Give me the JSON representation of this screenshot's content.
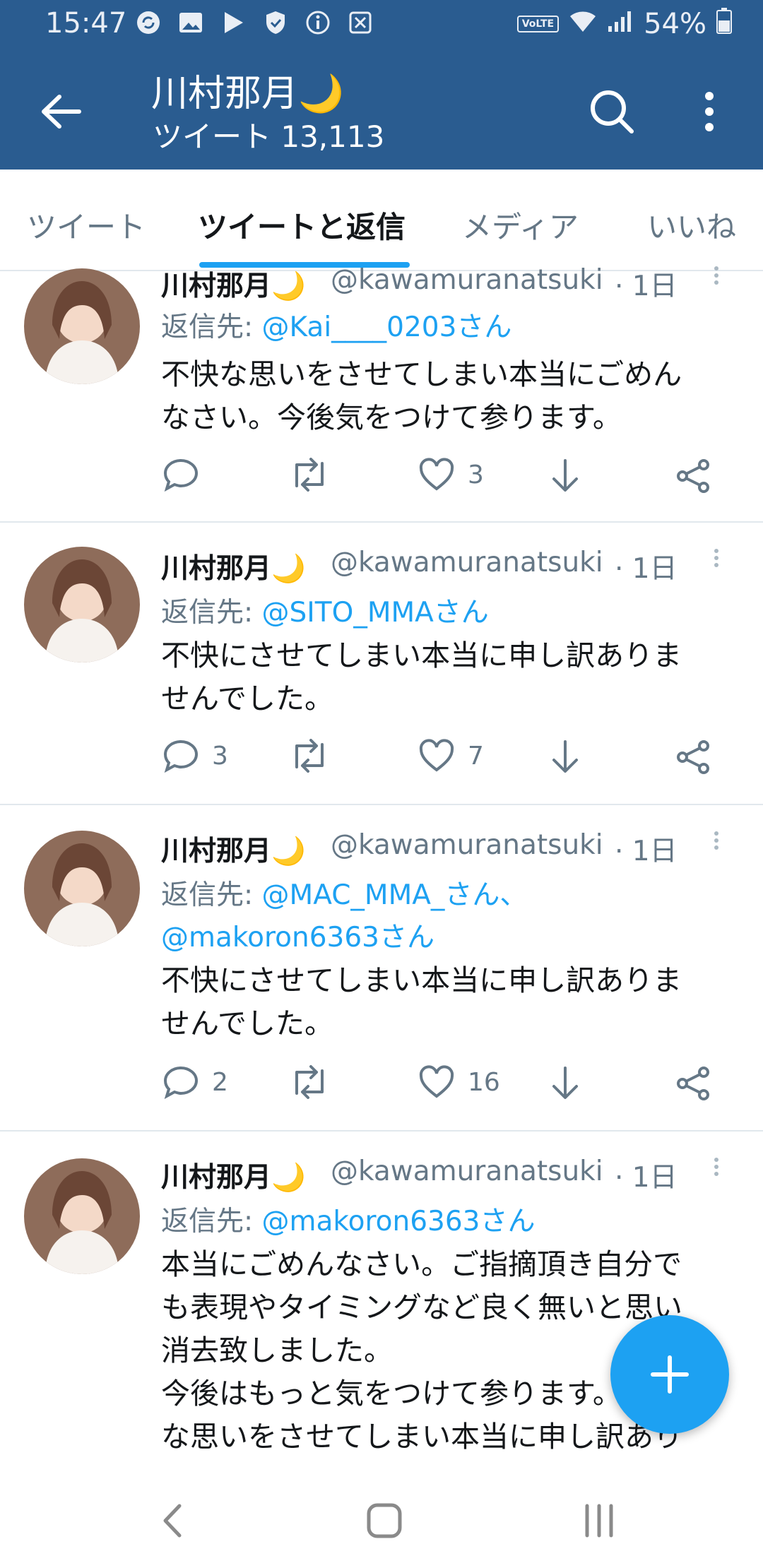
{
  "status_bar": {
    "time": "15:47",
    "volte": "VoLTE",
    "battery": "54%",
    "left_icons": [
      "sync-icon",
      "image-icon",
      "play-store-icon",
      "shield-icon",
      "info-icon",
      "ikimono-icon"
    ]
  },
  "header": {
    "title": "川村那月🌙",
    "tweet_count_label": "ツイート 13,113"
  },
  "tabs": [
    {
      "label": "ツイート",
      "active": false
    },
    {
      "label": "ツイートと返信",
      "active": true
    },
    {
      "label": "メディア",
      "active": false
    },
    {
      "label": "いいね",
      "active": false
    }
  ],
  "tweets": [
    {
      "name": "川村那月🌙",
      "handle": "@kawamuranatsuki",
      "time": "· 1日",
      "reply_prefix": "返信先:",
      "reply_accounts": [
        "@Kai____0203さん"
      ],
      "text_lines": [
        "不快な思いをさせてしまい本当にごめん",
        "なさい。今後気をつけて参ります。"
      ],
      "replies": "",
      "likes": "3"
    },
    {
      "name": "川村那月🌙",
      "handle": "@kawamuranatsuki",
      "time": "· 1日",
      "reply_prefix": "返信先:",
      "reply_accounts": [
        "@SITO_MMAさん"
      ],
      "text_lines": [
        "不快にさせてしまい本当に申し訳ありま",
        "せんでした。"
      ],
      "replies": "3",
      "likes": "7"
    },
    {
      "name": "川村那月🌙",
      "handle": "@kawamuranatsuki",
      "time": "· 1日",
      "reply_prefix": "返信先:",
      "reply_accounts": [
        "@MAC_MMA_さん、",
        "@makoron6363さん"
      ],
      "text_lines": [
        "不快にさせてしまい本当に申し訳ありま",
        "せんでした。"
      ],
      "replies": "2",
      "likes": "16"
    },
    {
      "name": "川村那月🌙",
      "handle": "@kawamuranatsuki",
      "time": "· 1日",
      "reply_prefix": "返信先:",
      "reply_accounts": [
        "@makoron6363さん"
      ],
      "text_lines": [
        "本当にごめんなさい。ご指摘頂き自分で",
        "も表現やタイミングなど良く無いと思い",
        "消去致しました。",
        "今後はもっと気をつけて参ります。不快",
        "な思いをさせてしまい本当に申し訳あり"
      ]
    }
  ],
  "fab": {
    "icon": "plus-icon"
  },
  "colors": {
    "header_bg": "#2a5c90",
    "accent": "#1da1f2",
    "secondary_text": "#657786"
  }
}
